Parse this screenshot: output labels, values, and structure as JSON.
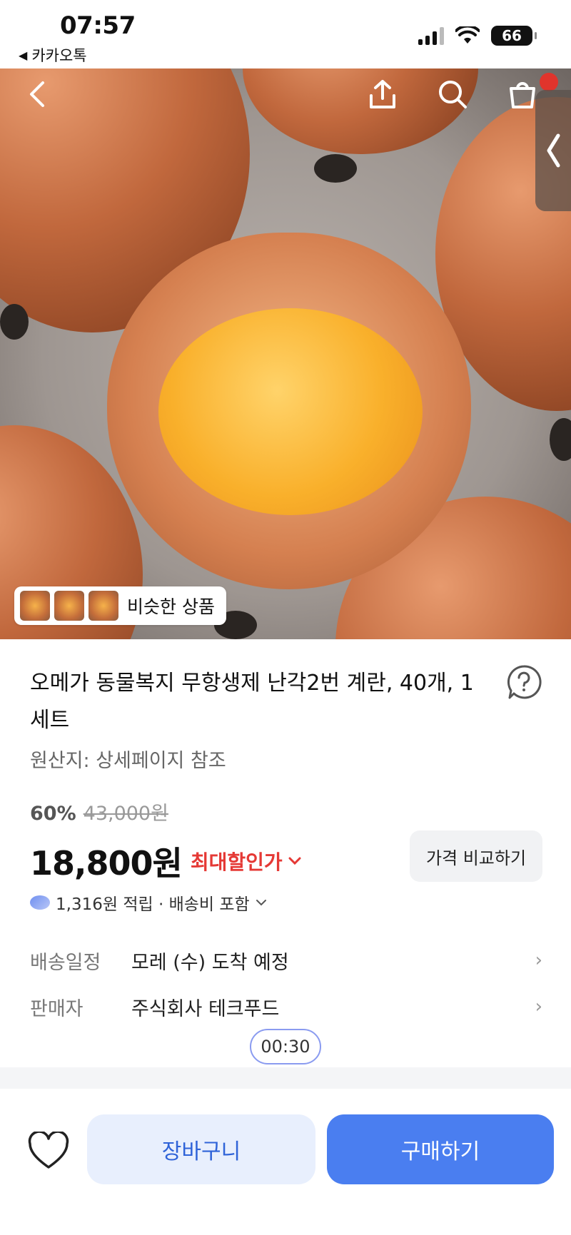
{
  "status_bar": {
    "time": "07:57",
    "back_app": "카카오톡",
    "battery": "66"
  },
  "header": {
    "icons": [
      "back-icon",
      "share-icon",
      "search-icon",
      "cart-icon",
      "side-panel-chevron-icon"
    ]
  },
  "similar": {
    "label": "비슷한 상품"
  },
  "product": {
    "title": "오메가 동물복지 무항생제 난각2번 계란, 40개, 1세트",
    "origin": "원산지: 상세페이지 참조",
    "discount_rate": "60%",
    "original_price": "43,000원",
    "price": "18,800원",
    "max_discount": "최대할인가",
    "compare_button": "가격 비교하기",
    "points": "1,316원 적립 · 배송비 포함"
  },
  "details": [
    {
      "label": "배송일정",
      "value": "모레 (수) 도착 예정"
    },
    {
      "label": "판매자",
      "value": "주식회사 테크푸드"
    }
  ],
  "timer": "00:30",
  "bottom_bar": {
    "cart_label": "장바구니",
    "buy_label": "구매하기"
  },
  "colors": {
    "accent": "#4a7ef0",
    "cart_bg": "#e8effd",
    "discount_red": "#e53935"
  }
}
